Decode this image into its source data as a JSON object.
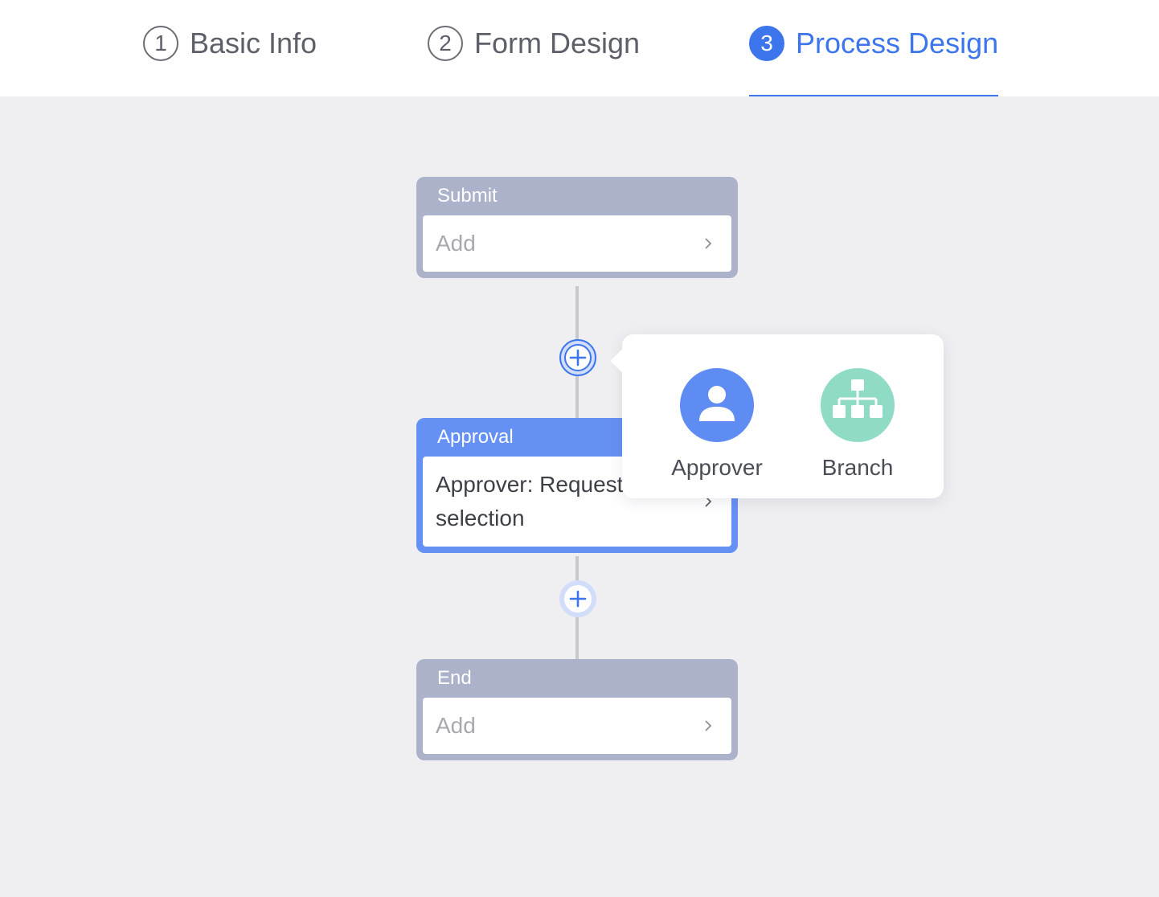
{
  "steps": [
    {
      "number": "1",
      "label": "Basic Info",
      "active": false
    },
    {
      "number": "2",
      "label": "Form Design",
      "active": false
    },
    {
      "number": "3",
      "label": "Process Design",
      "active": true
    }
  ],
  "nodes": {
    "submit": {
      "title": "Submit",
      "content": "Add"
    },
    "approval": {
      "title": "Approval",
      "content": "Approver: Request self-selection"
    },
    "end": {
      "title": "End",
      "content": "Add"
    }
  },
  "popover": {
    "items": [
      {
        "label": "Approver",
        "icon": "user-icon",
        "color": "#5f8cf2"
      },
      {
        "label": "Branch",
        "icon": "org-chart-icon",
        "color": "#8fdbc5"
      }
    ]
  },
  "colors": {
    "accent": "#3c75ec",
    "node_grey": "#acb2ca",
    "node_blue": "#6590f4"
  }
}
